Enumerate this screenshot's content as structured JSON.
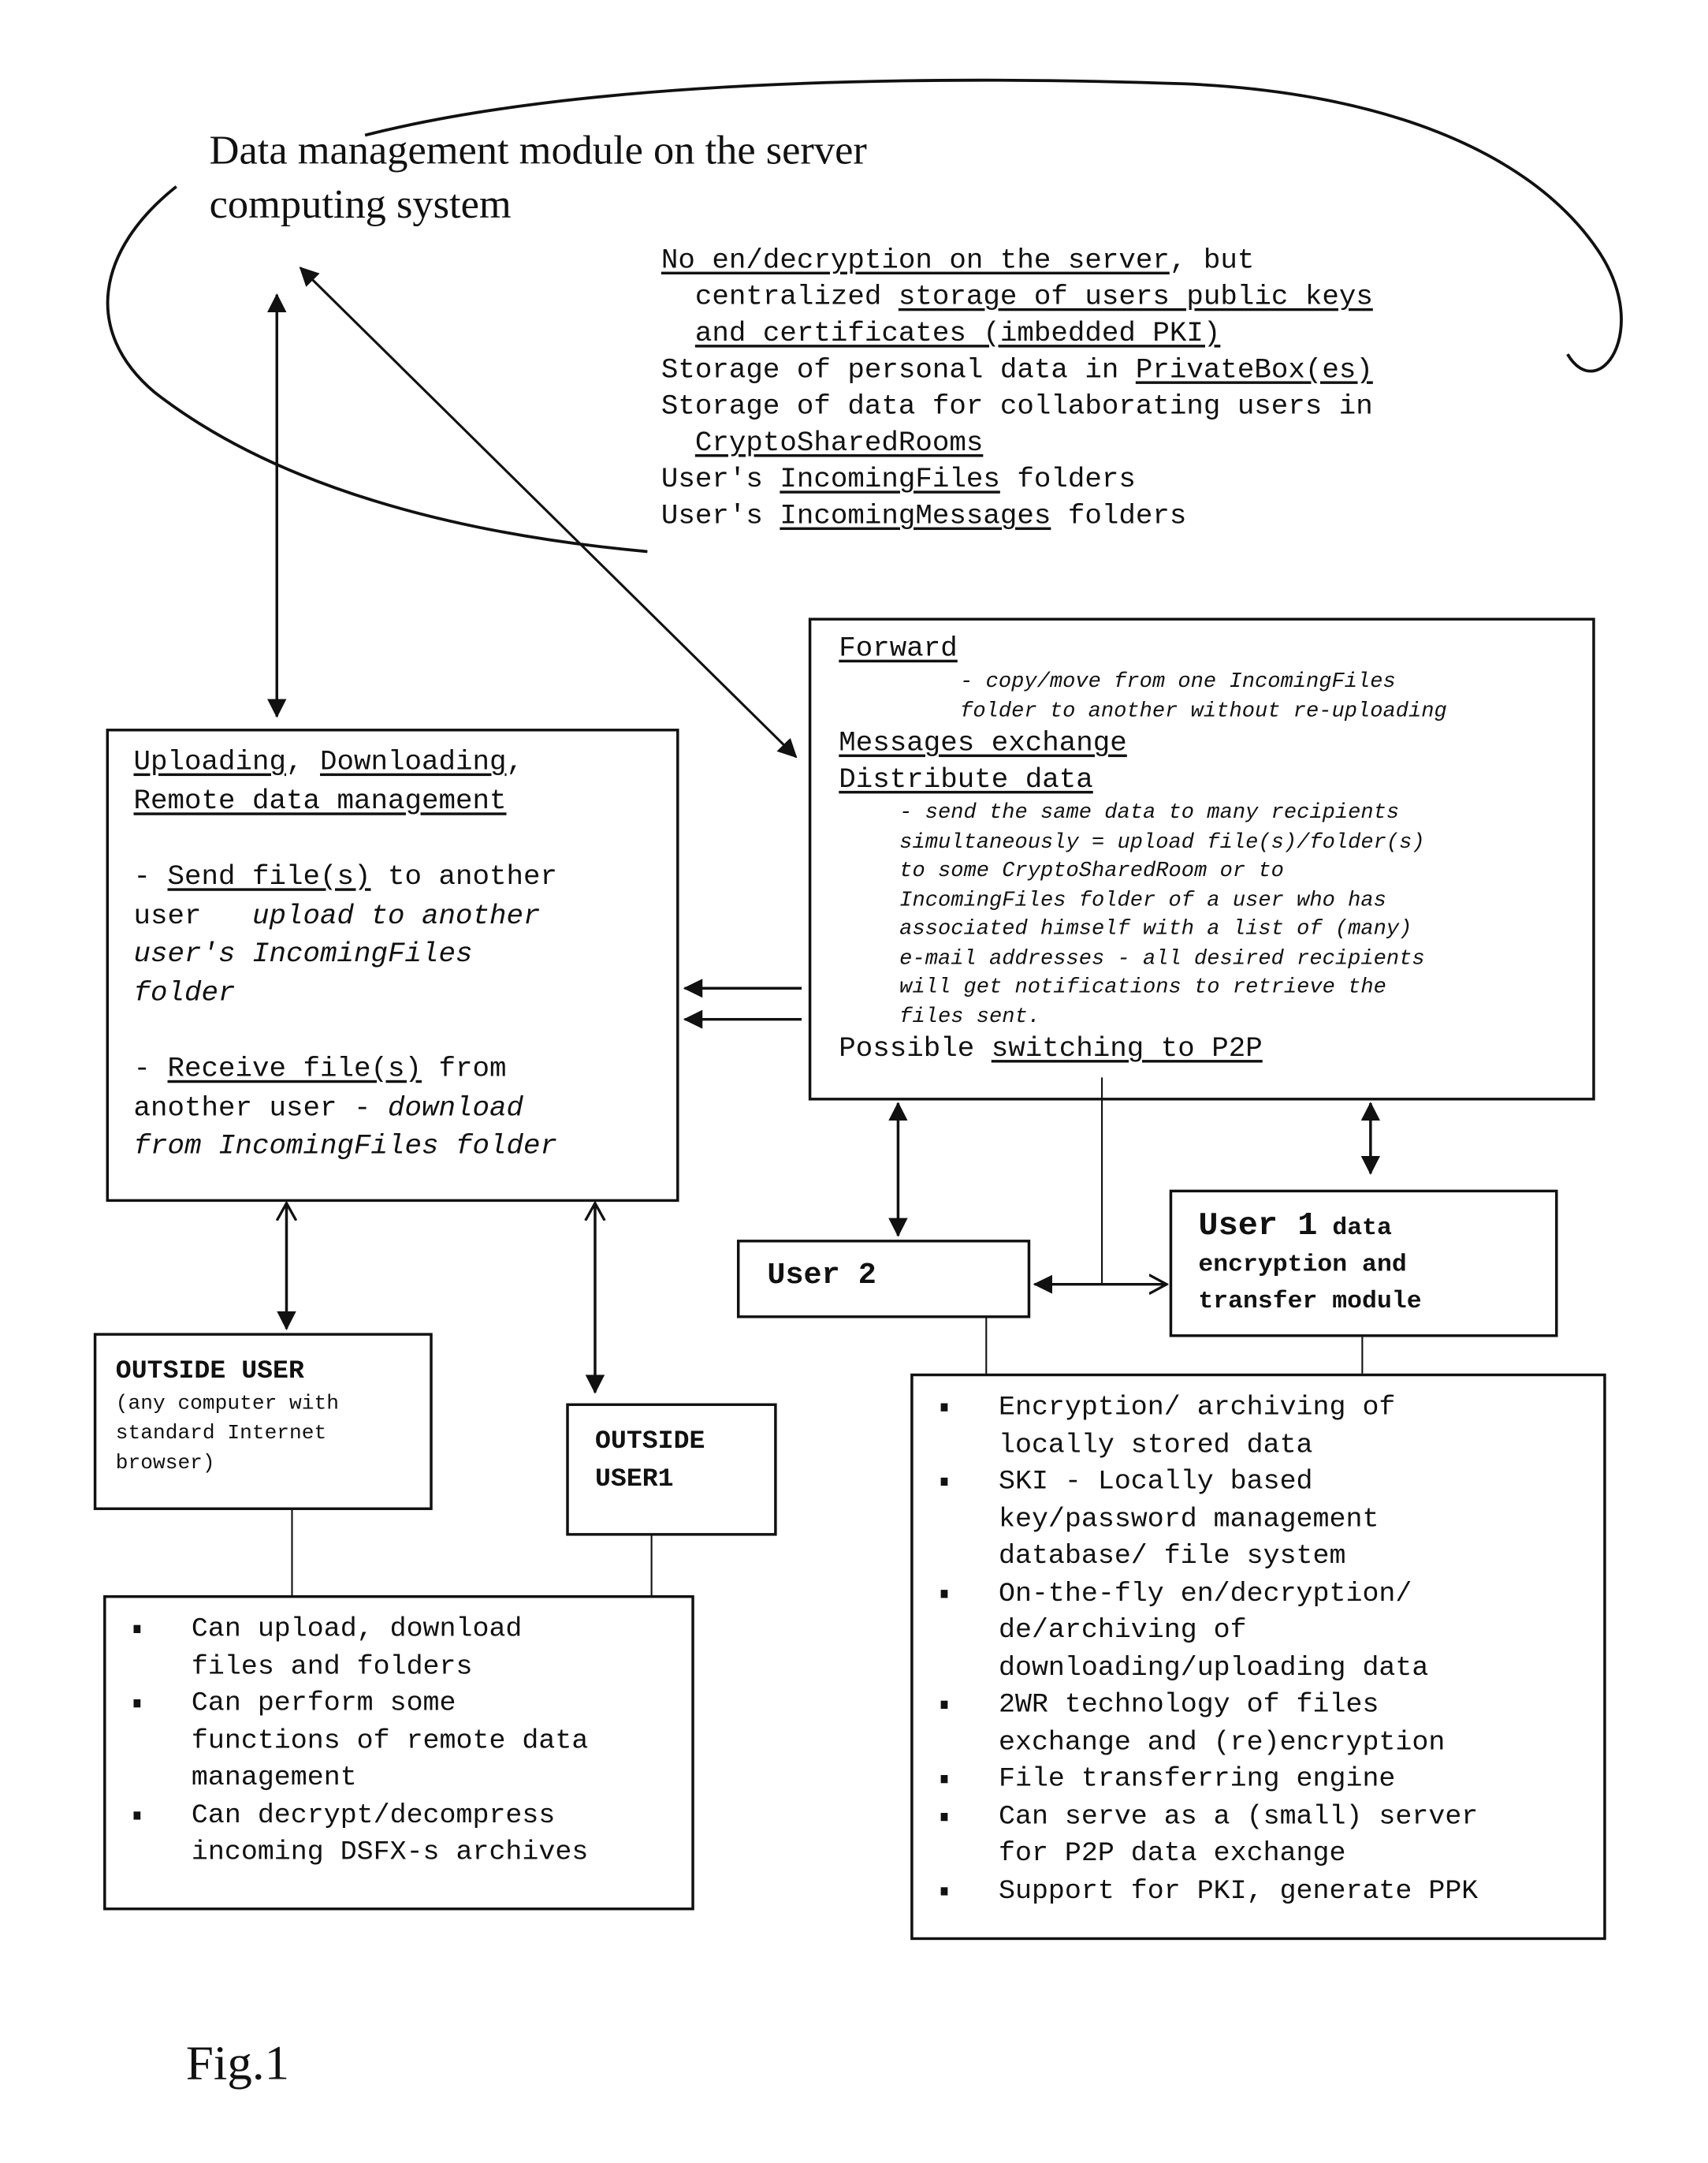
{
  "figure_label": "Fig.1",
  "server_module": {
    "title_lines": [
      "Data management module on the server",
      "computing system"
    ],
    "notes": [
      [
        {
          "t": "No en/decryption on the server",
          "u": true
        },
        {
          "t": ", but",
          "u": false
        }
      ],
      [
        {
          "t": "  centralized ",
          "u": false
        },
        {
          "t": "storage of users public keys",
          "u": true
        }
      ],
      [
        {
          "t": "  ",
          "u": false
        },
        {
          "t": "and certificates (imbedded PKI)",
          "u": true
        }
      ],
      [
        {
          "t": "Storage of personal data in ",
          "u": false
        },
        {
          "t": "PrivateBox(es)",
          "u": true
        }
      ],
      [
        {
          "t": "Storage of data for collaborating users in",
          "u": false
        }
      ],
      [
        {
          "t": "  ",
          "u": false
        },
        {
          "t": "CryptoSharedRooms",
          "u": true
        }
      ],
      [
        {
          "t": "User's ",
          "u": false
        },
        {
          "t": "IncomingFiles",
          "u": true
        },
        {
          "t": " folders",
          "u": false
        }
      ],
      [
        {
          "t": "User's ",
          "u": false
        },
        {
          "t": "IncomingMessages",
          "u": true
        },
        {
          "t": " folders",
          "u": false
        }
      ]
    ]
  },
  "upload_box": {
    "heading_1a": "Uploading",
    "heading_1b": ", ",
    "heading_1c": "Downloading",
    "heading_1d": ",",
    "heading_2": "Remote data management",
    "send_prefix": "- ",
    "send_link": "Send file(s)",
    "send_rest": " to another",
    "send_line2a": "user   ",
    "send_line2b": "upload to another",
    "send_line3": "user's IncomingFiles",
    "send_line4": "folder",
    "recv_prefix": "- ",
    "recv_link": "Receive file(s)",
    "recv_rest": " from",
    "recv_line2a": "another user - ",
    "recv_line2b": "download",
    "recv_line3": "from IncomingFiles folder"
  },
  "forward_box": {
    "forward": "Forward",
    "forward_desc": [
      "- copy/move from one IncomingFiles",
      "folder to another without re-uploading"
    ],
    "messages": "Messages exchange",
    "distribute": "Distribute data",
    "distribute_desc": [
      "- send the same data to many recipients",
      "simultaneously = upload file(s)/folder(s)",
      "to some CryptoSharedRoom or to",
      "IncomingFiles folder of a user who has",
      "associated himself with a list of (many)",
      "e-mail addresses - all desired recipients",
      "will get notifications to retrieve the",
      "files sent."
    ],
    "p2p_prefix": "Possible ",
    "p2p_link": "switching to P2P"
  },
  "user2": {
    "label": "User 2"
  },
  "user1": {
    "label_bold": "User 1",
    "label_rest": " data",
    "line2": "encryption and",
    "line3": "transfer module"
  },
  "outside_user": {
    "title": "OUTSIDE USER",
    "desc": [
      "(any computer with",
      "standard Internet",
      "browser)"
    ]
  },
  "outside_user1": {
    "lines": [
      "OUTSIDE",
      "USER1"
    ]
  },
  "outside_capabilities": [
    "Can upload, download\nfiles and folders",
    "Can perform some\nfunctions of remote data\nmanagement",
    "Can decrypt/decompress\nincoming DSFX-s archives"
  ],
  "user1_capabilities": [
    "Encryption/ archiving of\nlocally stored data",
    "SKI - Locally based\nkey/password management\ndatabase/ file system",
    "On-the-fly en/decryption/\nde/archiving of\ndownloading/uploading data",
    "2WR technology of files\nexchange and (re)encryption",
    "File transferring engine",
    "Can serve as a (small) server\nfor P2P data exchange",
    "Support for PKI, generate PPK"
  ]
}
